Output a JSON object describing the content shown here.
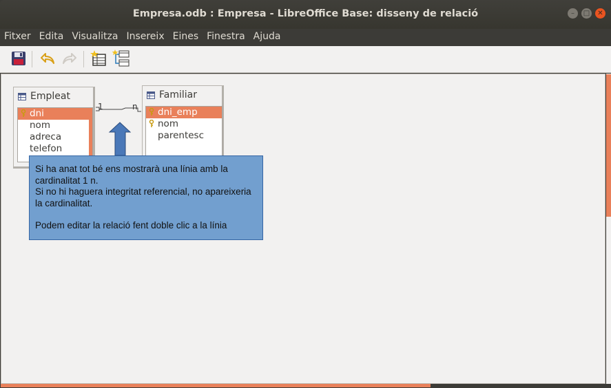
{
  "window": {
    "title": "Empresa.odb : Empresa - LibreOffice Base: disseny de relació",
    "controls": [
      "minimize-icon",
      "maximize-icon",
      "close-icon"
    ]
  },
  "menu": [
    "Fitxer",
    "Edita",
    "Visualitza",
    "Insereix",
    "Eines",
    "Finestra",
    "Ajuda"
  ],
  "toolbar": {
    "buttons": [
      {
        "name": "save-button",
        "icon": "save-icon"
      },
      {
        "name": "undo-button",
        "icon": "undo-icon"
      },
      {
        "name": "redo-button",
        "icon": "redo-icon"
      },
      {
        "name": "add-tables-button",
        "icon": "add-table-icon"
      },
      {
        "name": "new-relation-button",
        "icon": "relation-icon"
      }
    ]
  },
  "tables": {
    "empleat": {
      "title": "Empleat",
      "fields": [
        {
          "label": "dni",
          "key": true,
          "selected": true
        },
        {
          "label": "nom",
          "key": false,
          "selected": false
        },
        {
          "label": "adreca",
          "key": false,
          "selected": false
        },
        {
          "label": "telefon",
          "key": false,
          "selected": false
        }
      ]
    },
    "familiar": {
      "title": "Familiar",
      "fields": [
        {
          "label": "dni_emp",
          "key": true,
          "selected": true
        },
        {
          "label": "nom",
          "key": true,
          "selected": false
        },
        {
          "label": "parentesc",
          "key": false,
          "selected": false
        }
      ]
    }
  },
  "relation": {
    "left_card": "1",
    "right_card": "n"
  },
  "tooltip": {
    "line1": "Si ha anat tot bé ens mostrarà una línia amb la cardinalitat 1 n.",
    "line2": "Si no hi haguera integritat referencial, no apareixeria la cardinalitat.",
    "line3": "Podem editar la relació fent doble clic a la línia"
  },
  "colors": {
    "accent": "#e9805a",
    "tooltip_bg": "#729fcf",
    "titlebar": "#3c3b37"
  }
}
